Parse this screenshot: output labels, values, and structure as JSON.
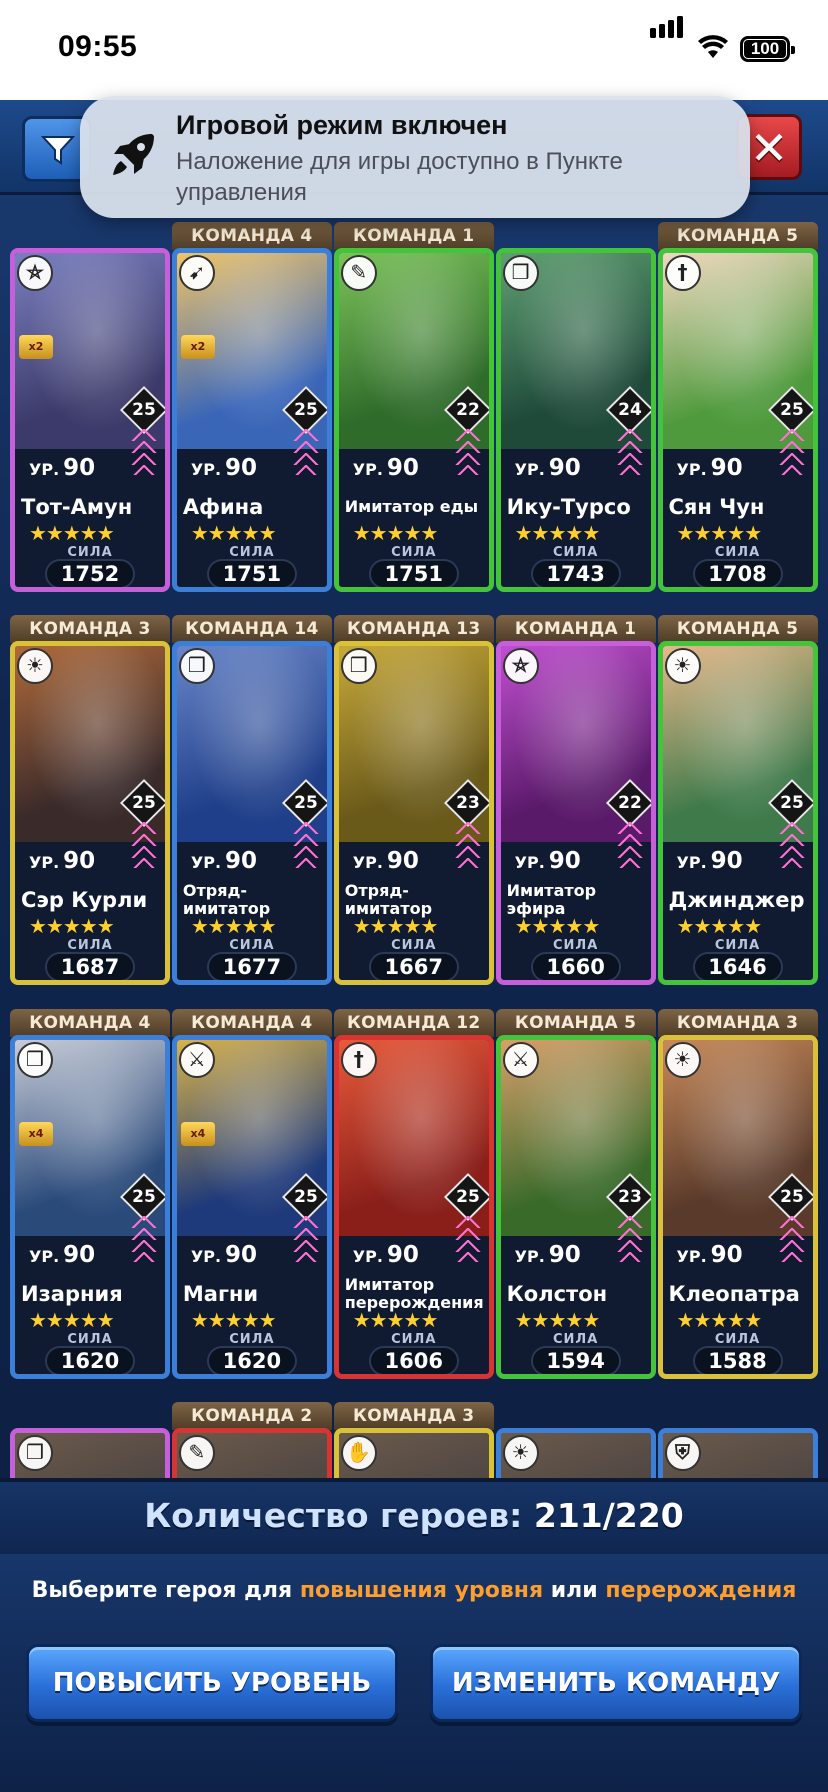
{
  "status_bar": {
    "time": "09:55",
    "battery": "100"
  },
  "notification": {
    "title": "Игровой режим включен",
    "body": "Наложение для игры доступно в Пункте управления"
  },
  "heroes": [
    {
      "team": "",
      "name": "Тот-Амун",
      "level_label": "УР.",
      "level": "90",
      "badge": "25",
      "power_label": "СИЛА",
      "power": "1752",
      "rarity": "purple",
      "class_icon": "pentagram-icon",
      "art": "#3c3a6a",
      "art2": "#7a7fc0",
      "tag": "x2"
    },
    {
      "team": "КОМАНДА 4",
      "name": "Афина",
      "level_label": "УР.",
      "level": "90",
      "badge": "25",
      "power_label": "СИЛА",
      "power": "1751",
      "rarity": "blue",
      "class_icon": "bow-icon",
      "art": "#3a66b8",
      "art2": "#f1c567",
      "tag": "x2"
    },
    {
      "team": "КОМАНДА 1",
      "name": "Имитатор еды",
      "level_label": "УР.",
      "level": "90",
      "badge": "22",
      "power_label": "СИЛА",
      "power": "1751",
      "rarity": "green",
      "class_icon": "feather-icon",
      "art": "#2f6b2a",
      "art2": "#7cc35a",
      "tag": ""
    },
    {
      "team": "",
      "name": "Ику-Турсо",
      "level_label": "УР.",
      "level": "90",
      "badge": "24",
      "power_label": "СИЛА",
      "power": "1743",
      "rarity": "green",
      "class_icon": "book-icon",
      "art": "#1f4a3a",
      "art2": "#5fa071",
      "tag": ""
    },
    {
      "team": "КОМАНДА 5",
      "name": "Сян Чун",
      "level_label": "УР.",
      "level": "90",
      "badge": "25",
      "power_label": "СИЛА",
      "power": "1708",
      "rarity": "green",
      "class_icon": "dagger-icon",
      "art": "#4f9a3c",
      "art2": "#f2d8c0",
      "tag": ""
    },
    {
      "team": "КОМАНДА 3",
      "name": "Сэр Курли",
      "level_label": "УР.",
      "level": "90",
      "badge": "25",
      "power_label": "СИЛА",
      "power": "1687",
      "rarity": "yellow",
      "class_icon": "sun-icon",
      "art": "#3a2a2a",
      "art2": "#b06a3a",
      "tag": ""
    },
    {
      "team": "КОМАНДА 14",
      "name": "Отряд-\nимитатор",
      "level_label": "УР.",
      "level": "90",
      "badge": "25",
      "power_label": "СИЛА",
      "power": "1677",
      "rarity": "blue",
      "class_icon": "book-icon",
      "art": "#1f3f8a",
      "art2": "#6a86c8",
      "tag": ""
    },
    {
      "team": "КОМАНДА 13",
      "name": "Отряд-\nимитатор",
      "level_label": "УР.",
      "level": "90",
      "badge": "23",
      "power_label": "СИЛА",
      "power": "1667",
      "rarity": "yellow",
      "class_icon": "book-icon",
      "art": "#6a5a1a",
      "art2": "#c8a93a",
      "tag": ""
    },
    {
      "team": "КОМАНДА 1",
      "name": "Имитатор\nэфира",
      "level_label": "УР.",
      "level": "90",
      "badge": "22",
      "power_label": "СИЛА",
      "power": "1660",
      "rarity": "purple",
      "class_icon": "pentagram-icon",
      "art": "#5a1a6a",
      "art2": "#c04fd0",
      "tag": ""
    },
    {
      "team": "КОМАНДА 5",
      "name": "Джинджер",
      "level_label": "УР.",
      "level": "90",
      "badge": "25",
      "power_label": "СИЛА",
      "power": "1646",
      "rarity": "green",
      "class_icon": "sun-icon",
      "art": "#3f7a4a",
      "art2": "#e8b88a",
      "tag": ""
    },
    {
      "team": "КОМАНДА 4",
      "name": "Изарния",
      "level_label": "УР.",
      "level": "90",
      "badge": "25",
      "power_label": "СИЛА",
      "power": "1620",
      "rarity": "blue",
      "class_icon": "book-icon",
      "art": "#2a4a7a",
      "art2": "#c8ccd8",
      "tag": "x4"
    },
    {
      "team": "КОМАНДА 4",
      "name": "Магни",
      "level_label": "УР.",
      "level": "90",
      "badge": "25",
      "power_label": "СИЛА",
      "power": "1620",
      "rarity": "blue",
      "class_icon": "swords-icon",
      "art": "#1f3a7a",
      "art2": "#d8b24a",
      "tag": "x4"
    },
    {
      "team": "КОМАНДА 12",
      "name": "Имитатор\nперерождения",
      "level_label": "УР.",
      "level": "90",
      "badge": "25",
      "power_label": "СИЛА",
      "power": "1606",
      "rarity": "red",
      "class_icon": "dagger-icon",
      "art": "#8a1f1a",
      "art2": "#e85a3a",
      "tag": ""
    },
    {
      "team": "КОМАНДА 5",
      "name": "Колстон",
      "level_label": "УР.",
      "level": "90",
      "badge": "23",
      "power_label": "СИЛА",
      "power": "1594",
      "rarity": "green",
      "class_icon": "swords-icon",
      "art": "#3a6a2a",
      "art2": "#d8a06a",
      "tag": ""
    },
    {
      "team": "КОМАНДА 3",
      "name": "Клеопатра",
      "level_label": "УР.",
      "level": "90",
      "badge": "25",
      "power_label": "СИЛА",
      "power": "1588",
      "rarity": "yellow",
      "class_icon": "sun-icon",
      "art": "#5a3a2a",
      "art2": "#c88a5a",
      "tag": ""
    }
  ],
  "peek_row": [
    {
      "team": "",
      "class_icon": "book-icon",
      "rarity": "purple"
    },
    {
      "team": "КОМАНДА 2",
      "class_icon": "feather-icon",
      "rarity": "red"
    },
    {
      "team": "КОМАНДА 3",
      "class_icon": "hand-icon",
      "rarity": "yellow"
    },
    {
      "team": "",
      "class_icon": "sun-icon",
      "rarity": "blue"
    },
    {
      "team": "",
      "class_icon": "shield-icon",
      "rarity": "blue"
    }
  ],
  "footer": {
    "count_label": "Количество героев:",
    "count_value": "211/220",
    "hint_prefix": "Выберите героя для",
    "hint_level": "повышения уровня",
    "hint_or": "или",
    "hint_rebirth": "перерождения",
    "level_up_button": "ПОВЫСИТЬ УРОВЕНЬ",
    "change_team_button": "ИЗМЕНИТЬ КОМАНДУ"
  }
}
